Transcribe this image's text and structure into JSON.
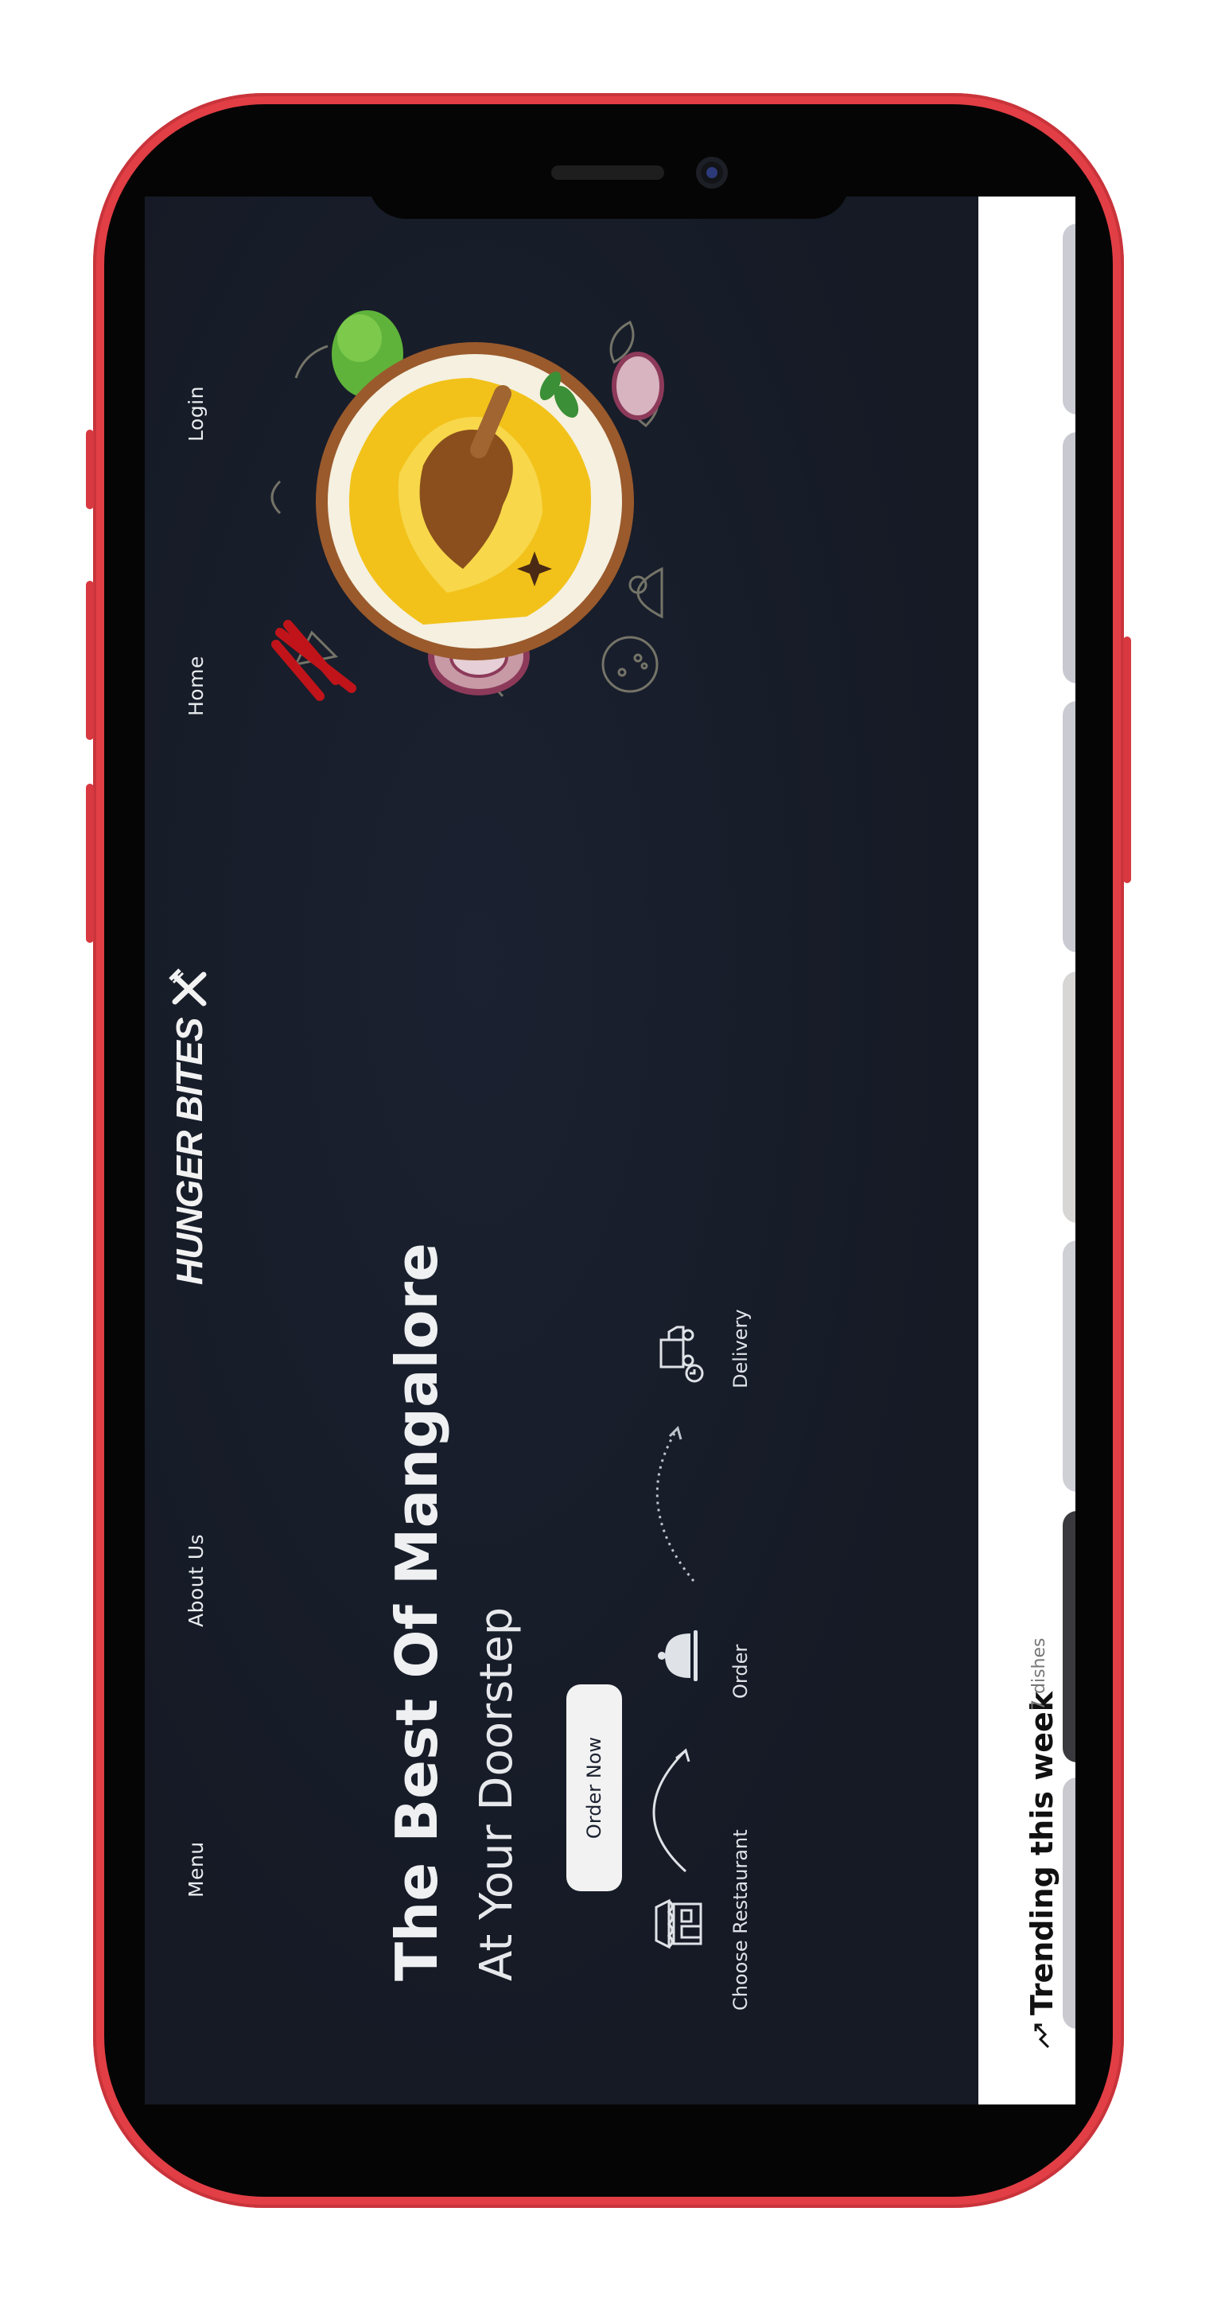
{
  "nav": {
    "menu": "Menu",
    "about": "About Us",
    "home": "Home",
    "login": "Login"
  },
  "brand": {
    "name": "HUNGER BITES",
    "icon": "fork-knife-cross-icon"
  },
  "hero": {
    "title": "The Best Of Mangalore",
    "subtitle": "At Your Doorstep",
    "cta": "Order Now"
  },
  "steps": [
    {
      "label": "Choose Restaurant",
      "icon": "storefront-icon"
    },
    {
      "label": "Order",
      "icon": "cloche-icon"
    },
    {
      "label": "Delivery",
      "icon": "delivery-truck-icon"
    }
  ],
  "trending": {
    "title": "Trending this week",
    "count": "7 dishes",
    "icon": "trending-up-icon"
  },
  "colors": {
    "frame": "#e23e45",
    "hero_bg": "#151a25",
    "text_light": "#eef0f2",
    "button_bg": "#f2f2f2"
  }
}
